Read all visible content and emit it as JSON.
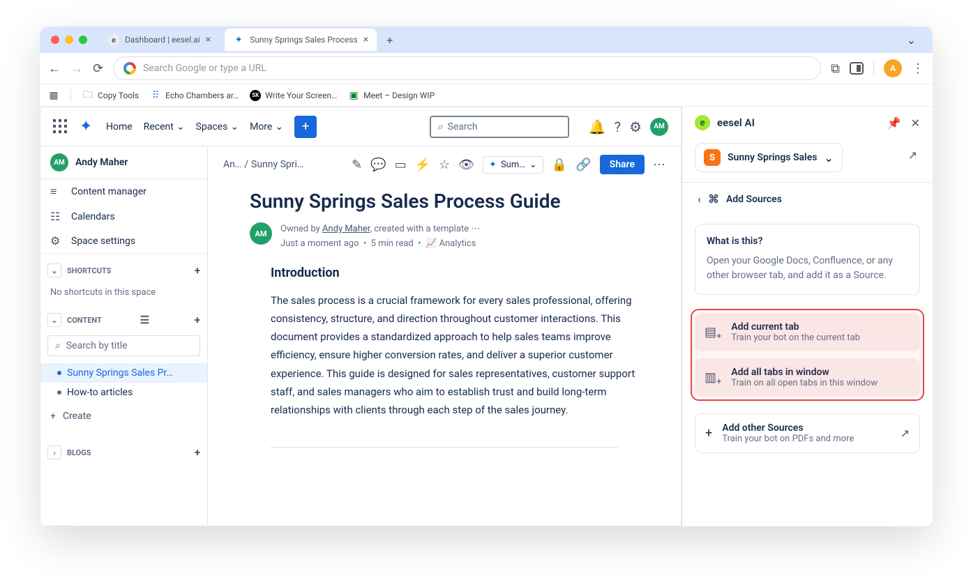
{
  "browser": {
    "tabs": [
      {
        "icon": "e",
        "title": "Dashboard | eesel.ai",
        "active": false
      },
      {
        "icon": "conf",
        "title": "Sunny Springs Sales Process",
        "active": true
      }
    ],
    "address_placeholder": "Search Google or type a URL",
    "bookmarks": [
      {
        "icon": "folder",
        "label": "Copy Tools"
      },
      {
        "icon": "grid",
        "label": "Echo Chambers ar…"
      },
      {
        "icon": "sk",
        "label": "Write Your Screen…"
      },
      {
        "icon": "meet",
        "label": "Meet – Design WIP"
      }
    ],
    "profile_initial": "A"
  },
  "confluence": {
    "nav": {
      "links": [
        "Home",
        "Recent",
        "Spaces",
        "More"
      ],
      "search_placeholder": "Search"
    },
    "user": {
      "initials": "AM",
      "name": "Andy Maher"
    },
    "sidebar": {
      "items": [
        {
          "icon": "▤",
          "label": "Content manager"
        },
        {
          "icon": "☷",
          "label": "Calendars"
        },
        {
          "icon": "⚙",
          "label": "Space settings"
        }
      ],
      "shortcuts_title": "SHORTCUTS",
      "shortcuts_empty": "No shortcuts in this space",
      "content_title": "CONTENT",
      "content_search_placeholder": "Search by title",
      "tree": [
        {
          "label": "Sunny Springs Sales Pr…",
          "selected": true
        },
        {
          "label": "How-to articles",
          "selected": false
        }
      ],
      "create_label": "Create",
      "blogs_title": "BLOGS"
    },
    "page": {
      "breadcrumb": [
        "An…",
        "Sunny Spri…"
      ],
      "summ_label": "Sum…",
      "share_label": "Share",
      "title": "Sunny Springs Sales Process Guide",
      "owned_by_prefix": "Owned by ",
      "owned_by_name": "Andy Maher",
      "owned_by_suffix": ", created with a template",
      "meta_time": "Just a moment ago",
      "meta_read": "5 min read",
      "meta_analytics": "Analytics",
      "h3": "Introduction",
      "body": "The sales process is a crucial framework for every sales professional, offering consistency, structure, and direction throughout customer interactions. This document provides a standardized approach to help sales teams improve efficiency, ensure higher conversion rates, and deliver a superior customer experience. This guide is designed for sales representatives, customer support staff, and sales managers who aim to establish trust and build long-term relationships with clients through each step of the sales journey."
    }
  },
  "panel": {
    "title": "eesel AI",
    "chip": {
      "initial": "S",
      "label": "Sunny Springs Sales"
    },
    "sub_title": "Add Sources",
    "info": {
      "title": "What is this?",
      "body": "Open your Google Docs, Confluence, or any other browser tab, and add it as a Source."
    },
    "cards": [
      {
        "title": "Add current tab",
        "sub": "Train your bot on the current tab"
      },
      {
        "title": "Add all tabs in window",
        "sub": "Train on all open tabs in this window"
      }
    ],
    "other": {
      "title": "Add other Sources",
      "sub": "Train your bot on PDFs and more"
    }
  }
}
